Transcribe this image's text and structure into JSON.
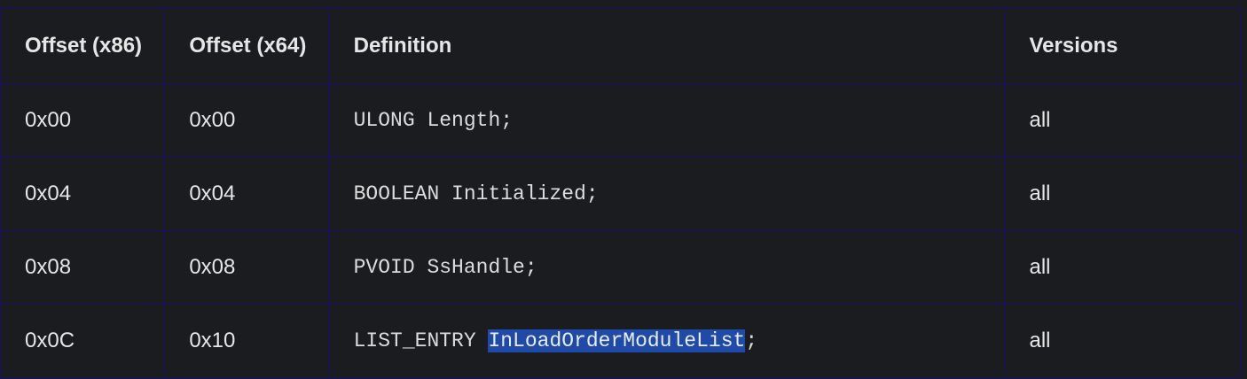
{
  "headers": {
    "x86": "Offset (x86)",
    "x64": "Offset (x64)",
    "definition": "Definition",
    "versions": "Versions"
  },
  "rows": [
    {
      "x86": "0x00",
      "x64": "0x00",
      "definition": "ULONG Length;",
      "versions": "all"
    },
    {
      "x86": "0x04",
      "x64": "0x04",
      "definition": "BOOLEAN Initialized;",
      "versions": "all"
    },
    {
      "x86": "0x08",
      "x64": "0x08",
      "definition": "PVOID SsHandle;",
      "versions": "all"
    },
    {
      "x86": "0x0C",
      "x64": "0x10",
      "definition_prefix": "LIST_ENTRY ",
      "definition_selected": "InLoadOrderModuleList",
      "definition_suffix": ";",
      "versions": "all"
    }
  ],
  "colors": {
    "background": "#1b1c1f",
    "border": "#140e6e",
    "selection": "#1f4aa8"
  }
}
